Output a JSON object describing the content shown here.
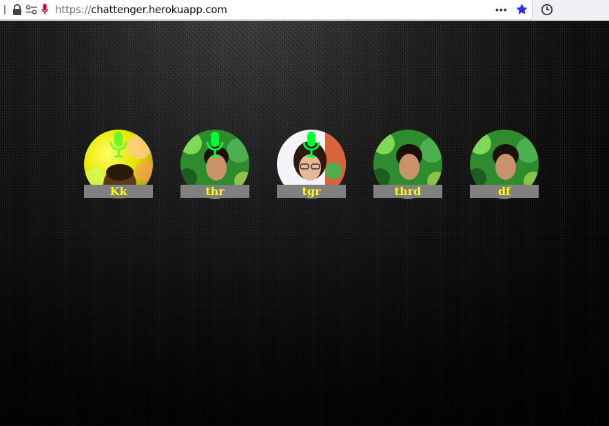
{
  "browser": {
    "url_protocol": "https://",
    "url_host": "chattenger.herokuapp.com",
    "more_label": "•••",
    "icons": [
      "lock-icon",
      "permissions-icon",
      "microphone-permission-icon",
      "page-actions-icon",
      "bookmark-star-icon",
      "history-icon"
    ],
    "star_color": "#2a2aff"
  },
  "participants": [
    {
      "name": "Kk",
      "avatar": "yellow-background-person",
      "mic_active": true
    },
    {
      "name": "thr",
      "avatar": "man-green-background",
      "mic_active": true
    },
    {
      "name": "tgr",
      "avatar": "woman-glasses",
      "mic_active": true
    },
    {
      "name": "thrd",
      "avatar": "man-green-background",
      "mic_active": false
    },
    {
      "name": "df",
      "avatar": "man-green-background",
      "mic_active": false
    }
  ],
  "colors": {
    "name_text": "#ffff00",
    "name_background": "#808080",
    "mic_icon": "#00ff33"
  }
}
